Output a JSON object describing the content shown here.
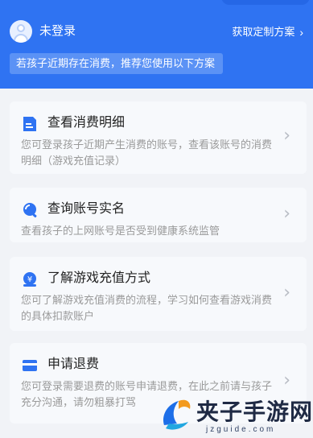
{
  "header": {
    "login_status": "未登录",
    "custom_plan_label": "获取定制方案",
    "chevron": "›",
    "notice": "若孩子近期存在消费，推荐您使用以下方案"
  },
  "cards": [
    {
      "title": "查看消费明细",
      "desc": "您可登录孩子近期产生消费的账号，查看该账号的消费明细（游戏充值记录）",
      "icon": "document-icon"
    },
    {
      "title": "查询账号实名",
      "desc": "查看孩子的上网账号是否受到健康系统监管",
      "icon": "search-icon"
    },
    {
      "title": "了解游戏充值方式",
      "desc": "您可了解游戏充值消费的流程，学习如何查看游戏消费的具体扣款账户",
      "icon": "yen-icon"
    },
    {
      "title": "申请退费",
      "desc": "您可登录需要退费的账号申请退费，在此之前请与孩子充分沟通，请勿粗暴打骂",
      "icon": "card-icon"
    }
  ],
  "arrow": "›",
  "watermark": {
    "text": "夹子手游网",
    "url": "jzguide.com"
  },
  "colors": {
    "brand_blue": "#2f73f2",
    "notice_bg": "#5b92f5",
    "card_bg": "#f7f9fc",
    "page_bg": "#f1f3f7"
  }
}
